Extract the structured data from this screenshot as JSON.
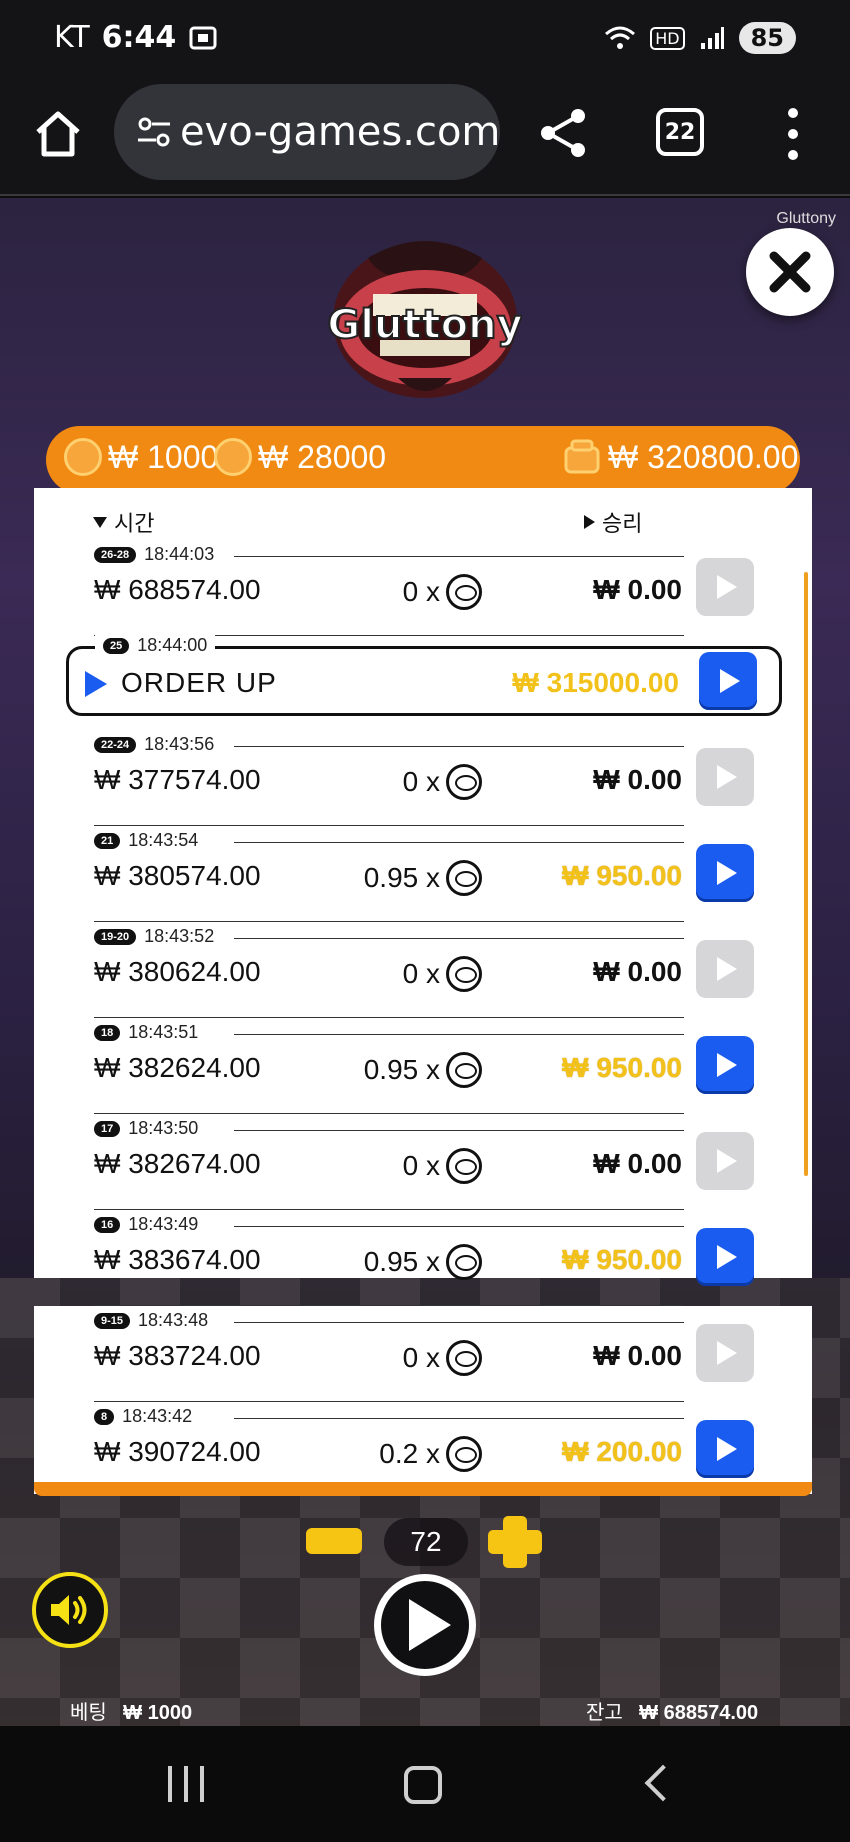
{
  "status": {
    "carrier": "KT",
    "time": "6:44",
    "network": "HD",
    "battery": "85"
  },
  "browser": {
    "url": "evo-games.com",
    "tab_count": "22"
  },
  "game": {
    "name": "Gluttony",
    "logo_text": "Gluttony",
    "top_bar": {
      "bet_amount": "₩ 1000",
      "coin_amount": "₩ 28000",
      "wallet_amount": "₩ 320800.00"
    },
    "history": {
      "time_header": "시간",
      "win_header": "승리",
      "rows": [
        {
          "rounds": "26-28",
          "time": "18:44:03",
          "balance": "₩ 688574.00",
          "multiplier": "0 x",
          "win": "₩ 0.00",
          "gold": false,
          "active": false
        },
        {
          "rounds": "22-24",
          "time": "18:43:56",
          "balance": "₩ 377574.00",
          "multiplier": "0 x",
          "win": "₩ 0.00",
          "gold": false,
          "active": false
        },
        {
          "rounds": "21",
          "time": "18:43:54",
          "balance": "₩ 380574.00",
          "multiplier": "0.95 x",
          "win": "₩ 950.00",
          "gold": true,
          "active": true
        },
        {
          "rounds": "19-20",
          "time": "18:43:52",
          "balance": "₩ 380624.00",
          "multiplier": "0 x",
          "win": "₩ 0.00",
          "gold": false,
          "active": false
        },
        {
          "rounds": "18",
          "time": "18:43:51",
          "balance": "₩ 382624.00",
          "multiplier": "0.95 x",
          "win": "₩ 950.00",
          "gold": true,
          "active": true
        },
        {
          "rounds": "17",
          "time": "18:43:50",
          "balance": "₩ 382674.00",
          "multiplier": "0 x",
          "win": "₩ 0.00",
          "gold": false,
          "active": false
        },
        {
          "rounds": "16",
          "time": "18:43:49",
          "balance": "₩ 383674.00",
          "multiplier": "0.95 x",
          "win": "₩ 950.00",
          "gold": true,
          "active": true
        },
        {
          "rounds": "9-15",
          "time": "18:43:48",
          "balance": "₩ 383724.00",
          "multiplier": "0 x",
          "win": "₩ 0.00",
          "gold": false,
          "active": false
        },
        {
          "rounds": "8",
          "time": "18:43:42",
          "balance": "₩ 390724.00",
          "multiplier": "0.2 x",
          "win": "₩ 200.00",
          "gold": true,
          "active": true
        }
      ],
      "feature": {
        "rounds": "25",
        "time": "18:44:00",
        "label": "ORDER UP",
        "win": "₩ 315000.00"
      }
    },
    "controls": {
      "count": "72",
      "bet_label": "베팅",
      "bet_value": "₩ 1000",
      "balance_label": "잔고",
      "balance_value": "₩ 688574.00"
    }
  },
  "colors": {
    "accent_orange": "#f08a12",
    "play_blue": "#1a5cf0",
    "win_gold": "#f2c21a"
  }
}
